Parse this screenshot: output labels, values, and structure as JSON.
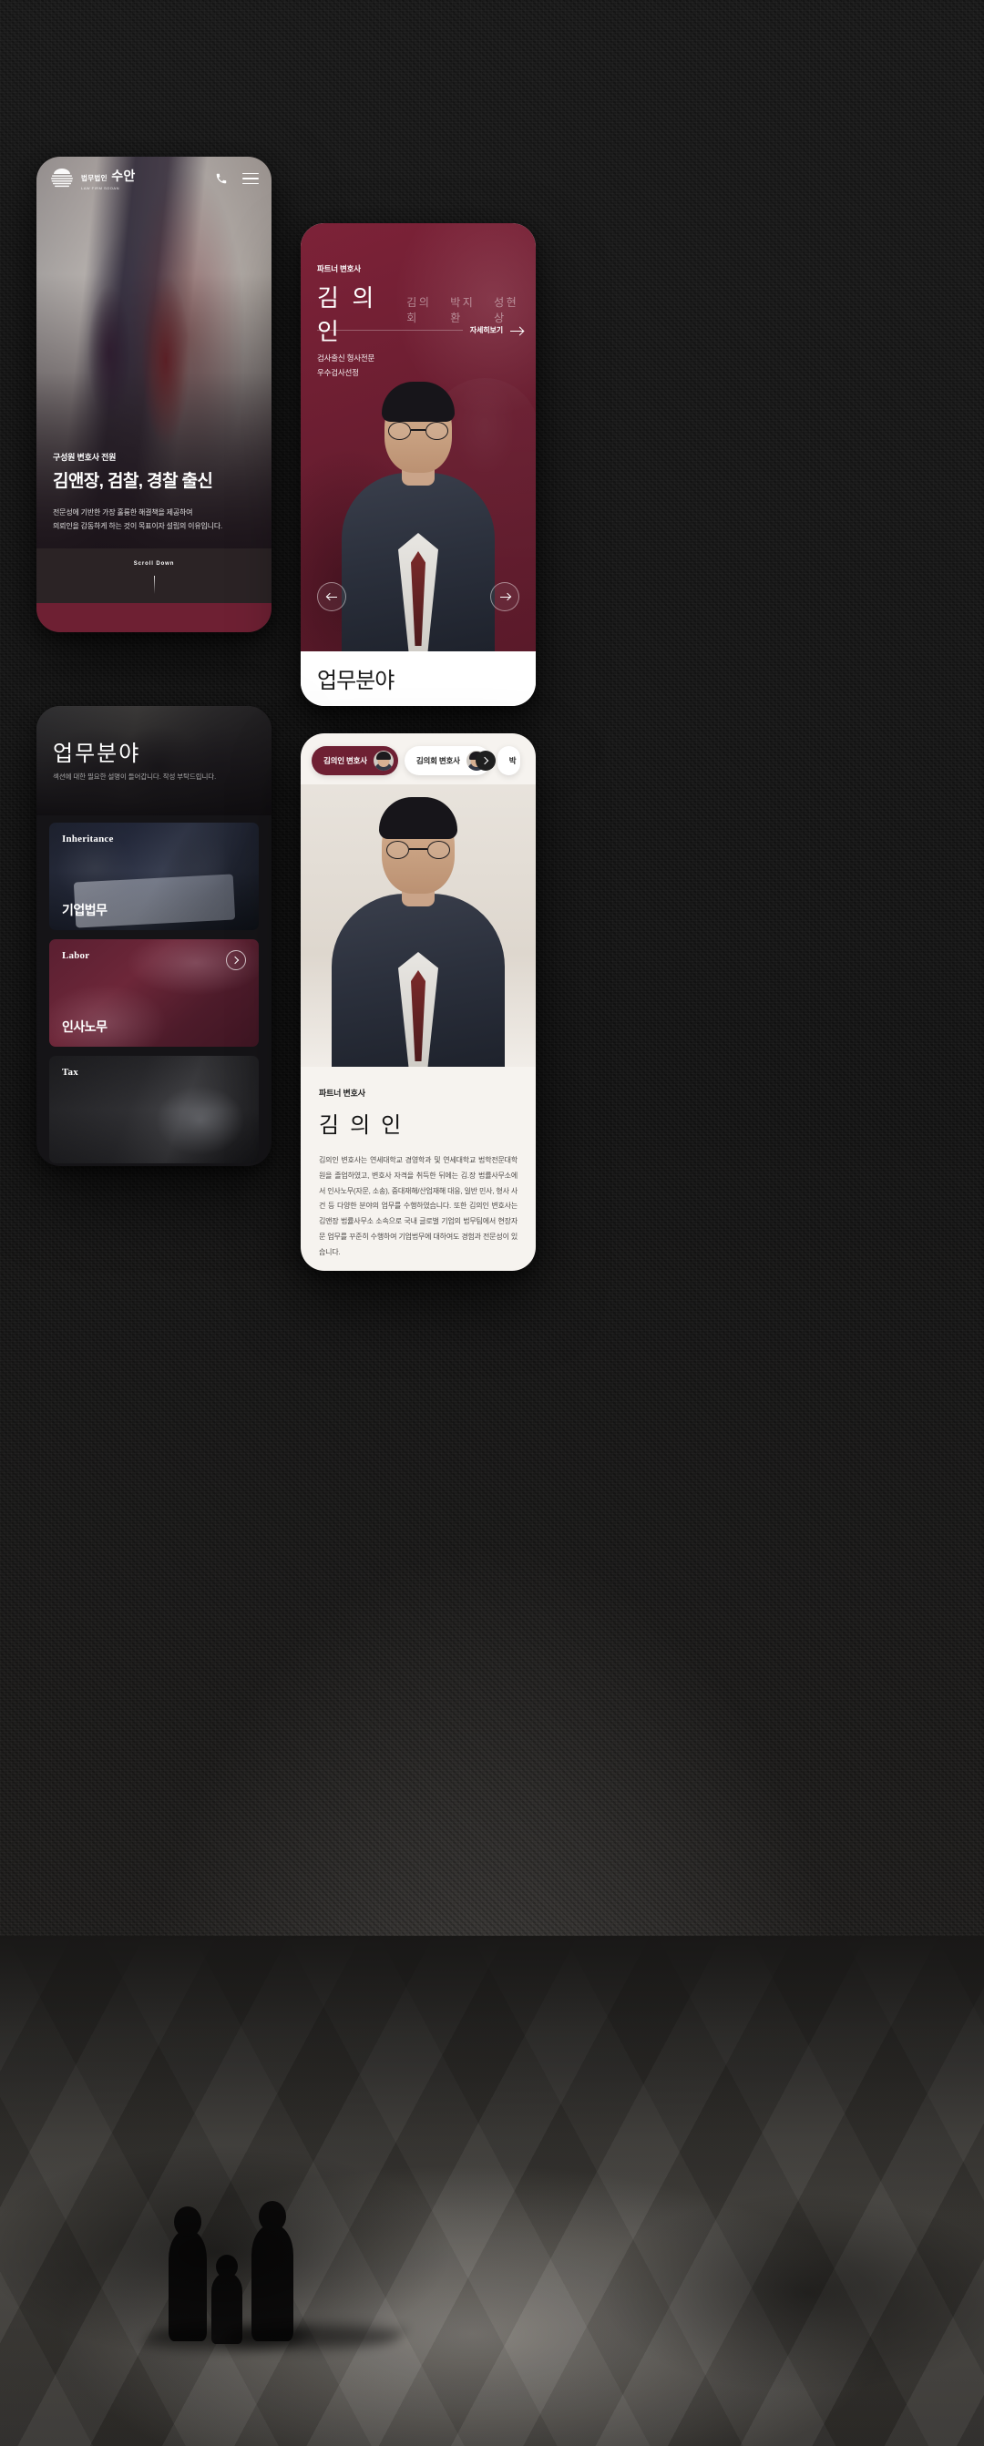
{
  "background": {
    "scene": "dark-textured-backdrop-with-lobby-floor-photo"
  },
  "hero_screen": {
    "header": {
      "logo_ko_small": "법무법인",
      "logo_ko_big": "수안",
      "logo_en": "LAW FIRM SOOAN",
      "phone_icon": "phone-icon",
      "menu_icon": "hamburger-menu-icon"
    },
    "eyebrow": "구성원 변호사 전원",
    "title": "김앤장, 검찰, 경찰 출신",
    "desc_line1": "전문성에 기반한 가장 훌륭한 해결책을 제공하여",
    "desc_line2": "의뢰인을 감동하게 하는 것이 목표이자 설립의 이유입니다.",
    "scroll_label": "Scroll Down",
    "accent_color": "#6e2033"
  },
  "partner_screen": {
    "eyebrow": "파트너 변호사",
    "active_name": "김 의 인",
    "other_names": [
      "김의회",
      "박지환",
      "성현상"
    ],
    "more_label": "자세히보기",
    "tags": [
      "검사출신 형사전문",
      "우수검사선정"
    ],
    "prev_label": "prev",
    "next_label": "next",
    "next_section_title": "업무분야",
    "card_color": "#6b1e31"
  },
  "business_screen": {
    "title": "업무분야",
    "subtitle": "섹션에 대한 필요한 설명이 들어갑니다. 작성 부탁드립니다.",
    "cards": [
      {
        "en": "Inheritance",
        "ko": "기업법무",
        "has_arrow": false
      },
      {
        "en": "Labor",
        "ko": "인사노무",
        "has_arrow": true
      },
      {
        "en": "Tax",
        "ko": "",
        "has_arrow": false
      }
    ]
  },
  "detail_screen": {
    "tabs": [
      {
        "label": "김의인 변호사",
        "active": true
      },
      {
        "label": "김의회 변호사",
        "active": false
      },
      {
        "label": "박",
        "active": false
      }
    ],
    "next_icon": "arrow-right-icon",
    "eyebrow": "파트너 변호사",
    "name": "김 의 인",
    "description": "김의인 변호사는 연세대학교 경영학과 및 연세대학교 법학전문대학원을 졸업하였고, 변호사 자격을 취득한 뒤에는 김.장 법률사무소에서 인사노무(자문, 소송), 중대재해/산업재해 대응, 일반 민사, 형사 사건 등 다양한 분야의 업무를 수행하였습니다. 또한 김의인 변호사는 김앤장 법률사무소 소속으로 국내 글로벌 기업의 법무팀에서 현장자문 업무를 꾸준히 수행하여 기업법무에 대하여도 경험과 전문성이 있습니다."
  }
}
